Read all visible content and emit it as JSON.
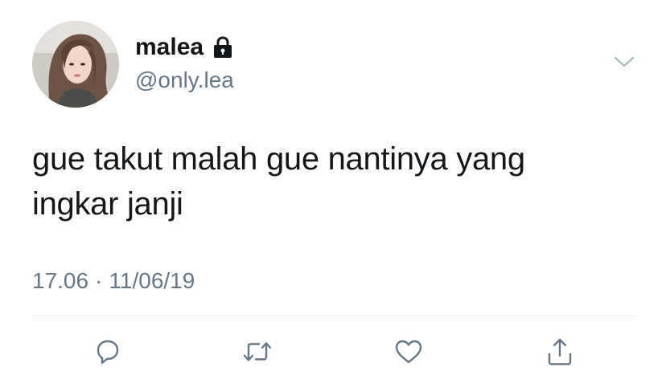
{
  "user": {
    "display_name": "malea",
    "handle": "@only.lea",
    "protected_icon": "lock-icon",
    "caret_icon": "chevron-down-icon"
  },
  "tweet": {
    "text_line1": "gue takut malah gue nantinya yang",
    "text_line2": "ingkar janji",
    "time": "17.06",
    "separator": "·",
    "date": "11/06/19"
  },
  "actions": [
    {
      "icon": "reply-icon"
    },
    {
      "icon": "retweet-icon"
    },
    {
      "icon": "like-icon"
    },
    {
      "icon": "share-icon"
    }
  ],
  "colors": {
    "text": "#14171a",
    "secondary": "#657786",
    "divider": "#e1e8ed"
  }
}
